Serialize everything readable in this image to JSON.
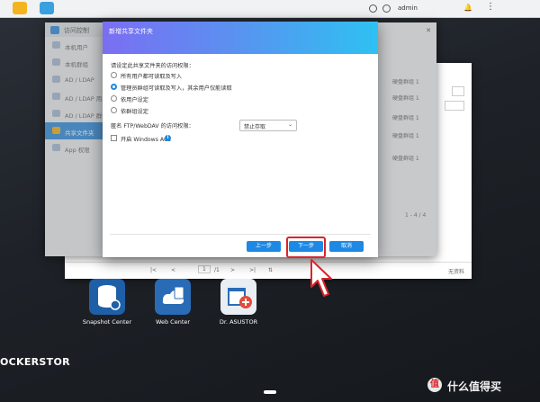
{
  "topbar": {
    "username": "admin"
  },
  "back_window": {
    "pager": {
      "page": "1",
      "of_pages": "/1",
      "right_label": "无资料"
    }
  },
  "main_window": {
    "title": "访问控制",
    "sidebar": [
      {
        "label": "本机用户"
      },
      {
        "label": "本机群组"
      },
      {
        "label": "AD / LDAP"
      },
      {
        "label": "AD / LDAP 用户"
      },
      {
        "label": "AD / LDAP 群组"
      },
      {
        "label": "共享文件夹",
        "active": true
      },
      {
        "label": "App 权限"
      }
    ],
    "right_column": [
      "硬盘群组 1",
      "硬盘群组 1",
      "硬盘群组 1",
      "硬盘群组 1",
      "硬盘群组 1"
    ],
    "count": "1 - 4 / 4"
  },
  "dialog": {
    "title": "新增共享文件夹",
    "prompt": "请设定此共享文件夹的访问权限：",
    "options": [
      {
        "label": "所有用户都可读取及写入",
        "selected": false
      },
      {
        "label": "管理员群组可读取及写入，其余用户仅能读取",
        "selected": true
      },
      {
        "label": "依用户设定",
        "selected": false
      },
      {
        "label": "依群组设定",
        "selected": false
      }
    ],
    "ftp_label": "匿名 FTP/WebDAV 的访问权限：",
    "ftp_value": "禁止存取",
    "acl_label": "开启 Windows ACL",
    "buttons": {
      "prev": "上一步",
      "next": "下一步",
      "cancel": "取消"
    }
  },
  "desktop": {
    "icons": [
      {
        "label": "Snapshot Center"
      },
      {
        "label": "Web Center"
      },
      {
        "label": "Dr. ASUSTOR"
      }
    ],
    "brand": "OCKERSTOR"
  },
  "watermark": {
    "text": "什么值得买"
  },
  "colors": {
    "accent": "#1e88e5",
    "highlight": "#d9252b",
    "sidebar_active": "#5aa4e6"
  }
}
